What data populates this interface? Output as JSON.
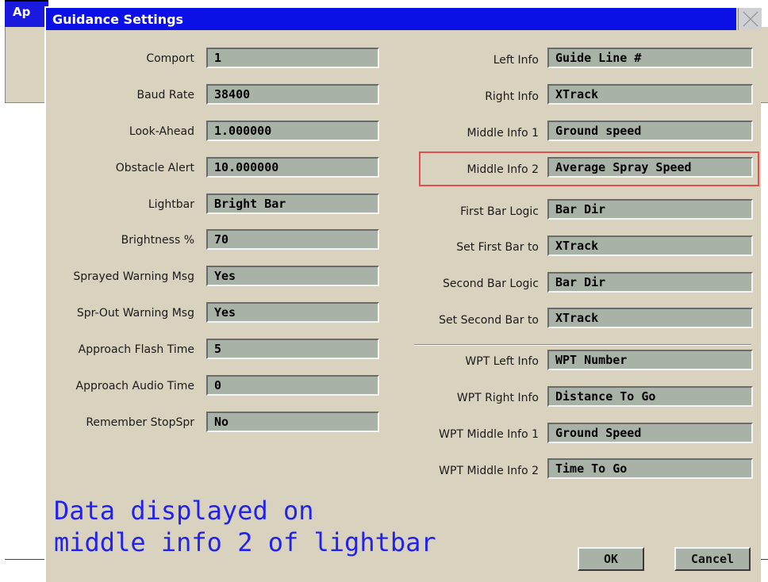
{
  "background_app": {
    "title_fragment": "Ap"
  },
  "dialog": {
    "title": "Guidance Settings",
    "left_fields": [
      {
        "label": "Comport",
        "value": "1"
      },
      {
        "label": "Baud Rate",
        "value": "38400"
      },
      {
        "label": "Look-Ahead",
        "value": "1.000000"
      },
      {
        "label": "Obstacle Alert",
        "value": "10.000000"
      },
      {
        "label": "Lightbar",
        "value": "Bright Bar"
      },
      {
        "label": "Brightness %",
        "value": "70"
      },
      {
        "label": "Sprayed Warning Msg",
        "value": "Yes"
      },
      {
        "label": "Spr-Out Warning Msg",
        "value": "Yes"
      },
      {
        "label": "Approach Flash Time",
        "value": "5"
      },
      {
        "label": "Approach Audio Time",
        "value": "0"
      },
      {
        "label": "Remember StopSpr",
        "value": "No"
      }
    ],
    "right_fields": [
      {
        "label": "Left Info",
        "value": "Guide Line #"
      },
      {
        "label": "Right Info",
        "value": "XTrack"
      },
      {
        "label": "Middle Info 1",
        "value": "Ground speed"
      },
      {
        "label": "Middle Info 2",
        "value": "Average Spray Speed"
      },
      {
        "label": "First Bar Logic",
        "value": "Bar Dir"
      },
      {
        "label": "Set First Bar to",
        "value": "XTrack"
      },
      {
        "label": "Second Bar Logic",
        "value": "Bar Dir"
      },
      {
        "label": "Set Second Bar to",
        "value": "XTrack"
      }
    ],
    "wpt_fields": [
      {
        "label": "WPT Left Info",
        "value": "WPT Number"
      },
      {
        "label": "WPT Right Info",
        "value": "Distance To Go"
      },
      {
        "label": "WPT Middle Info 1",
        "value": "Ground Speed"
      },
      {
        "label": "WPT Middle Info 2",
        "value": "Time To Go"
      }
    ],
    "caption": {
      "line1": "Data displayed on",
      "line2": "middle info 2 of lightbar"
    },
    "buttons": {
      "ok": "OK",
      "cancel": "Cancel"
    }
  },
  "colors": {
    "titlebar": "#0a10e6",
    "dialog_bg": "#d8d2be",
    "field_bg": "#a8b2a6",
    "highlight": "#e05050",
    "caption": "#2222ee"
  },
  "icons": {
    "close": "close-x-icon"
  }
}
